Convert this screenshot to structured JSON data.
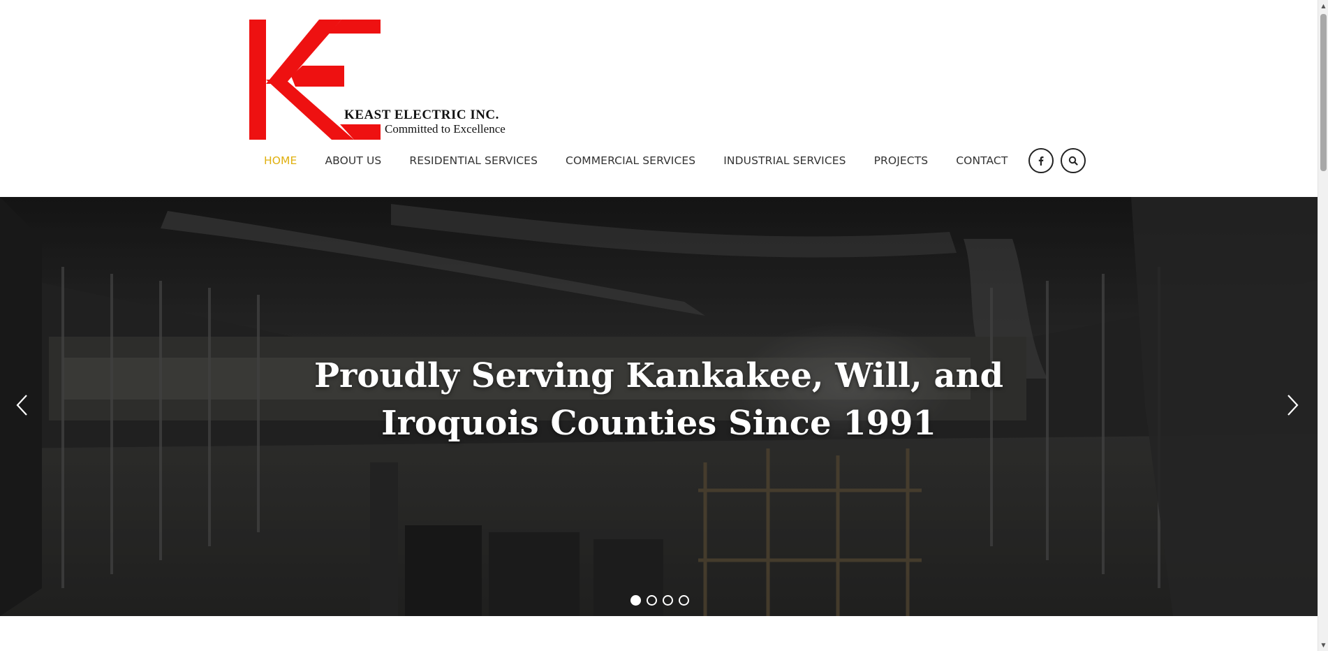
{
  "brand": {
    "name": "KEAST ELECTRIC INC.",
    "tagline": "Committed to Excellence",
    "accent_color": "#ee1111"
  },
  "nav": {
    "items": [
      {
        "label": "HOME",
        "active": true
      },
      {
        "label": "ABOUT US"
      },
      {
        "label": "RESIDENTIAL SERVICES"
      },
      {
        "label": "COMMERCIAL SERVICES"
      },
      {
        "label": "INDUSTRIAL SERVICES"
      },
      {
        "label": "PROJECTS"
      },
      {
        "label": "CONTACT"
      }
    ],
    "active_color": "#e0b010",
    "icons": [
      "facebook-icon",
      "search-icon"
    ]
  },
  "hero": {
    "title_line1": "Proudly Serving Kankakee, Will, and",
    "title_line2": "Iroquois Counties Since 1991",
    "slide_count": 4,
    "active_slide": 1
  }
}
